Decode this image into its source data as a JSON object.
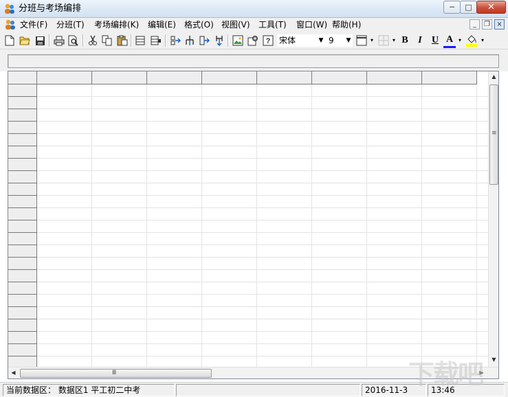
{
  "window": {
    "title": "分班与考场编排",
    "minimize_glyph": "─",
    "maximize_glyph": "□",
    "close_glyph": "✕"
  },
  "menubar": {
    "items": [
      {
        "label": "文件(F)"
      },
      {
        "label": "分班(T)"
      },
      {
        "label": "考场编排(K)"
      },
      {
        "label": "编辑(E)"
      },
      {
        "label": "格式(O)"
      },
      {
        "label": "视图(V)"
      },
      {
        "label": "工具(T)"
      },
      {
        "label": "窗口(W)"
      },
      {
        "label": "帮助(H)"
      }
    ],
    "mdi_minimize_glyph": "_",
    "mdi_restore_glyph": "❐",
    "mdi_close_glyph": "×"
  },
  "toolbar": {
    "icons": [
      "new-file-icon",
      "open-folder-icon",
      "save-icon",
      "print-icon",
      "print-preview-icon",
      "cut-icon",
      "copy-icon",
      "paste-icon",
      "insert-row-icon",
      "delete-row-icon",
      "merge-icon",
      "split-icon",
      "insert-column-icon",
      "filter-icon",
      "image-icon",
      "properties-icon",
      "help-icon"
    ],
    "font_name": "宋体",
    "font_size": "9",
    "bold_label": "B",
    "italic_label": "I",
    "underline_label": "U",
    "font_color_label": "A",
    "dropdown_glyph": "▼",
    "small_dropdown_glyph": "▾",
    "colors": {
      "font_color": "#1a1aff",
      "fill_color": "#ffff00"
    }
  },
  "grid": {
    "column_count": 8,
    "row_count": 23
  },
  "scrollbars": {
    "up_glyph": "▲",
    "down_glyph": "▼",
    "left_glyph": "◀",
    "right_glyph": "▶",
    "v_grip": "≡",
    "h_grip": "Ⅲ"
  },
  "statusbar": {
    "dataset_label": "当前数据区：",
    "dataset_value": "数据区1 平工初二中考",
    "date": "2016-11-3",
    "time": "13:46"
  },
  "watermark": "下载吧"
}
